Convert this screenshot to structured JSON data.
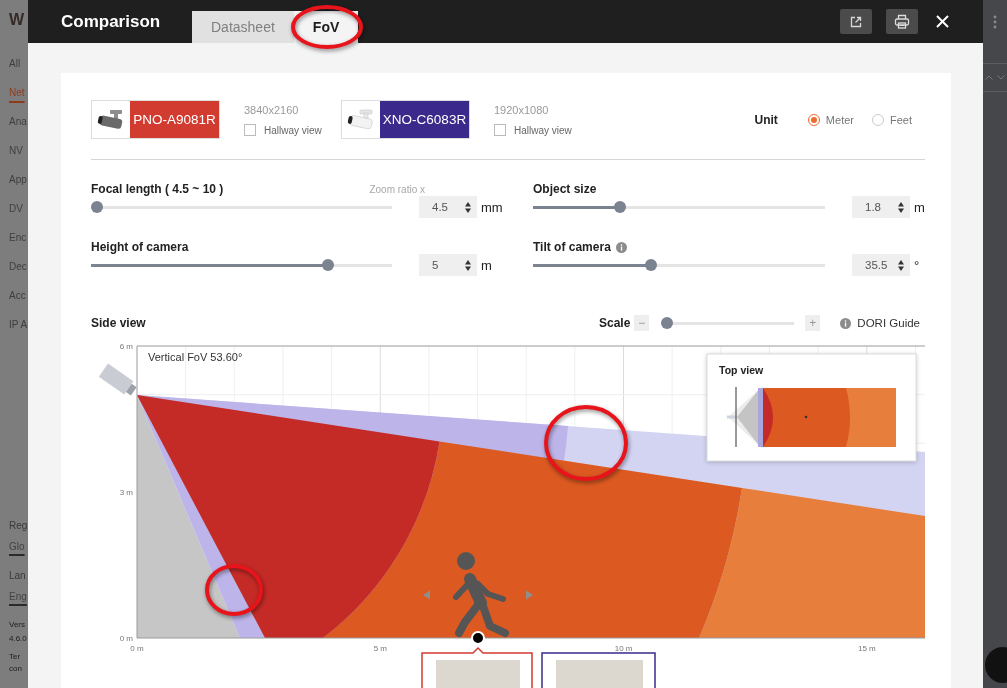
{
  "backdrop": {
    "logo": "W",
    "nav_items": [
      {
        "label": "All",
        "selected": false
      },
      {
        "label": "Net",
        "selected": true
      },
      {
        "label": "Ana",
        "selected": false
      },
      {
        "label": "NV",
        "selected": false
      },
      {
        "label": "App",
        "selected": false
      },
      {
        "label": "DV",
        "selected": false
      },
      {
        "label": "Enc",
        "selected": false
      },
      {
        "label": "Dec",
        "selected": false
      },
      {
        "label": "Acc",
        "selected": false
      },
      {
        "label": "IP A",
        "selected": false
      }
    ],
    "footer": [
      {
        "kind": "label",
        "text": "Reg"
      },
      {
        "kind": "link",
        "text": "Glo"
      },
      {
        "kind": "label",
        "text": "Lan"
      },
      {
        "kind": "link",
        "text": "Eng"
      },
      {
        "kind": "note",
        "text": "Vers"
      },
      {
        "kind": "note",
        "text": "4.6.0"
      },
      {
        "kind": "note",
        "text": "Ter"
      },
      {
        "kind": "note",
        "text": "con"
      }
    ]
  },
  "window": {
    "title": "Comparison"
  },
  "tabs": [
    {
      "label": "Datasheet",
      "selected": false,
      "circled": false
    },
    {
      "label": "FoV",
      "selected": true,
      "circled": true
    }
  ],
  "cameras": [
    {
      "model": "PNO-A9081R",
      "color": "#d23b2f",
      "resolution": "3840x2160",
      "hallway_label": "Hallway view",
      "hallway_view": false
    },
    {
      "model": "XNO-C6083R",
      "color": "#3b2a8b",
      "resolution": "1920x1080",
      "hallway_label": "Hallway view",
      "hallway_view": false
    }
  ],
  "unit": {
    "label": "Unit",
    "options": [
      {
        "label": "Meter",
        "selected": true
      },
      {
        "label": "Feet",
        "selected": false
      }
    ]
  },
  "parameters": [
    {
      "label": "Focal length ( 4.5 ~ 10 )",
      "hint": "Zoom ratio x",
      "info": false,
      "level": 0,
      "value": "4.5",
      "unit": "mm"
    },
    {
      "label": "Object size",
      "info": false,
      "level": 0.29,
      "value": "1.8",
      "unit": "m"
    },
    {
      "label": "Height of camera",
      "info": false,
      "level": 0.8,
      "value": "5",
      "unit": "m"
    },
    {
      "label": "Tilt of camera",
      "info": true,
      "level": 0.4,
      "value": "35.5",
      "unit": "°"
    }
  ],
  "side_view": {
    "title": "Side view",
    "scale": {
      "label": "Scale",
      "minus": "−",
      "plus": "+",
      "level": 0
    },
    "guide": "DORI Guide",
    "fov_label": "Vertical FoV 53.60°",
    "y_ticks": [
      "6 m",
      "3 m",
      "0 m"
    ],
    "x_ticks": [
      "0 m",
      "5 m",
      "10 m",
      "15 m"
    ],
    "top_view": {
      "title": "Top view"
    },
    "highlights": [
      {
        "kind": "ellipse"
      },
      {
        "kind": "ellipse"
      }
    ]
  }
}
